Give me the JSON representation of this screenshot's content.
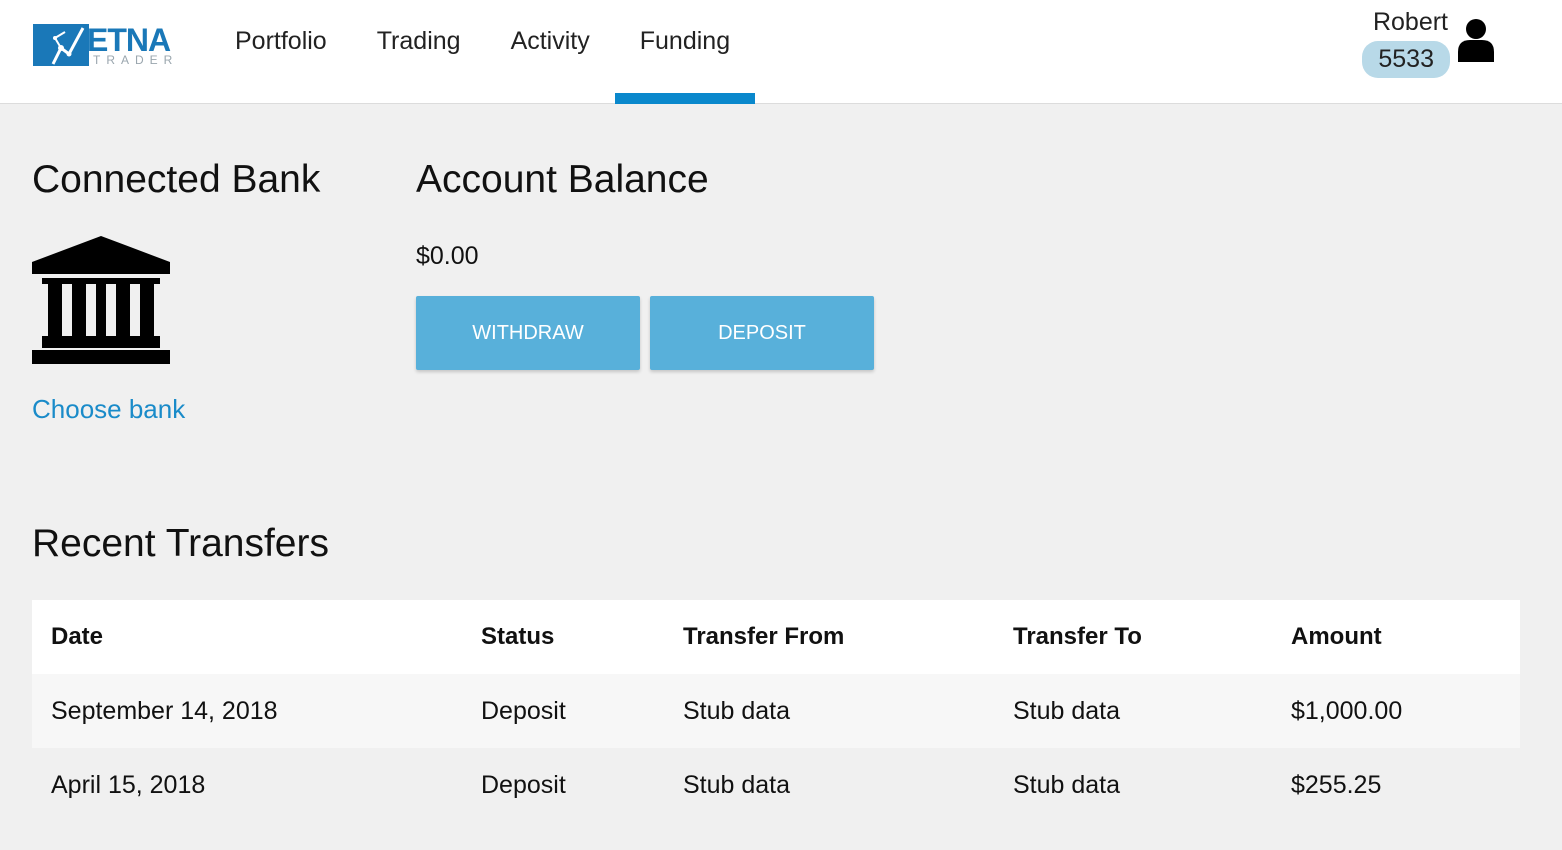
{
  "brand": {
    "name": "ETNA",
    "sub": "TRADER",
    "color": "#1a78b8"
  },
  "nav": {
    "items": [
      {
        "label": "Portfolio",
        "active": false
      },
      {
        "label": "Trading",
        "active": false
      },
      {
        "label": "Activity",
        "active": false
      },
      {
        "label": "Funding",
        "active": true
      }
    ],
    "accent": "#0a88cc"
  },
  "user": {
    "name": "Robert",
    "account": "5533",
    "icon": "user-icon"
  },
  "connected_bank": {
    "title": "Connected Bank",
    "icon": "bank-icon",
    "link_label": "Choose bank"
  },
  "account_balance": {
    "title": "Account Balance",
    "value": "$0.00",
    "withdraw_label": "WITHDRAW",
    "deposit_label": "DEPOSIT",
    "button_color": "#58b0da"
  },
  "transfers": {
    "title": "Recent Transfers",
    "columns": [
      "Date",
      "Status",
      "Transfer From",
      "Transfer To",
      "Amount"
    ],
    "rows": [
      [
        "September 14, 2018",
        "Deposit",
        "Stub data",
        "Stub data",
        "$1,000.00"
      ],
      [
        "April 15, 2018",
        "Deposit",
        "Stub data",
        "Stub data",
        "$255.25"
      ]
    ]
  }
}
